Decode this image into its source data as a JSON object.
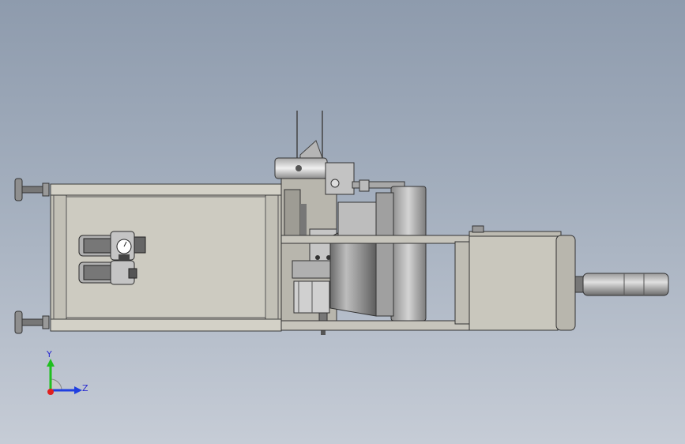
{
  "view": {
    "background_top": "#8e9bad",
    "background_bottom": "#c6ccd6"
  },
  "model": {
    "body_color": "#c9c7bd",
    "panel_color": "#cdcbc1",
    "edge_color": "#3a3a3a",
    "steel_color": "#9a9a9a",
    "dark_steel_color": "#4a4a4a"
  },
  "triad": {
    "y_label": "Y",
    "z_label": "Z",
    "y_color": "#1fbf1f",
    "z_color": "#1f3fe0",
    "x_color": "#e01f1f",
    "label_color": "#2a2ad0"
  }
}
